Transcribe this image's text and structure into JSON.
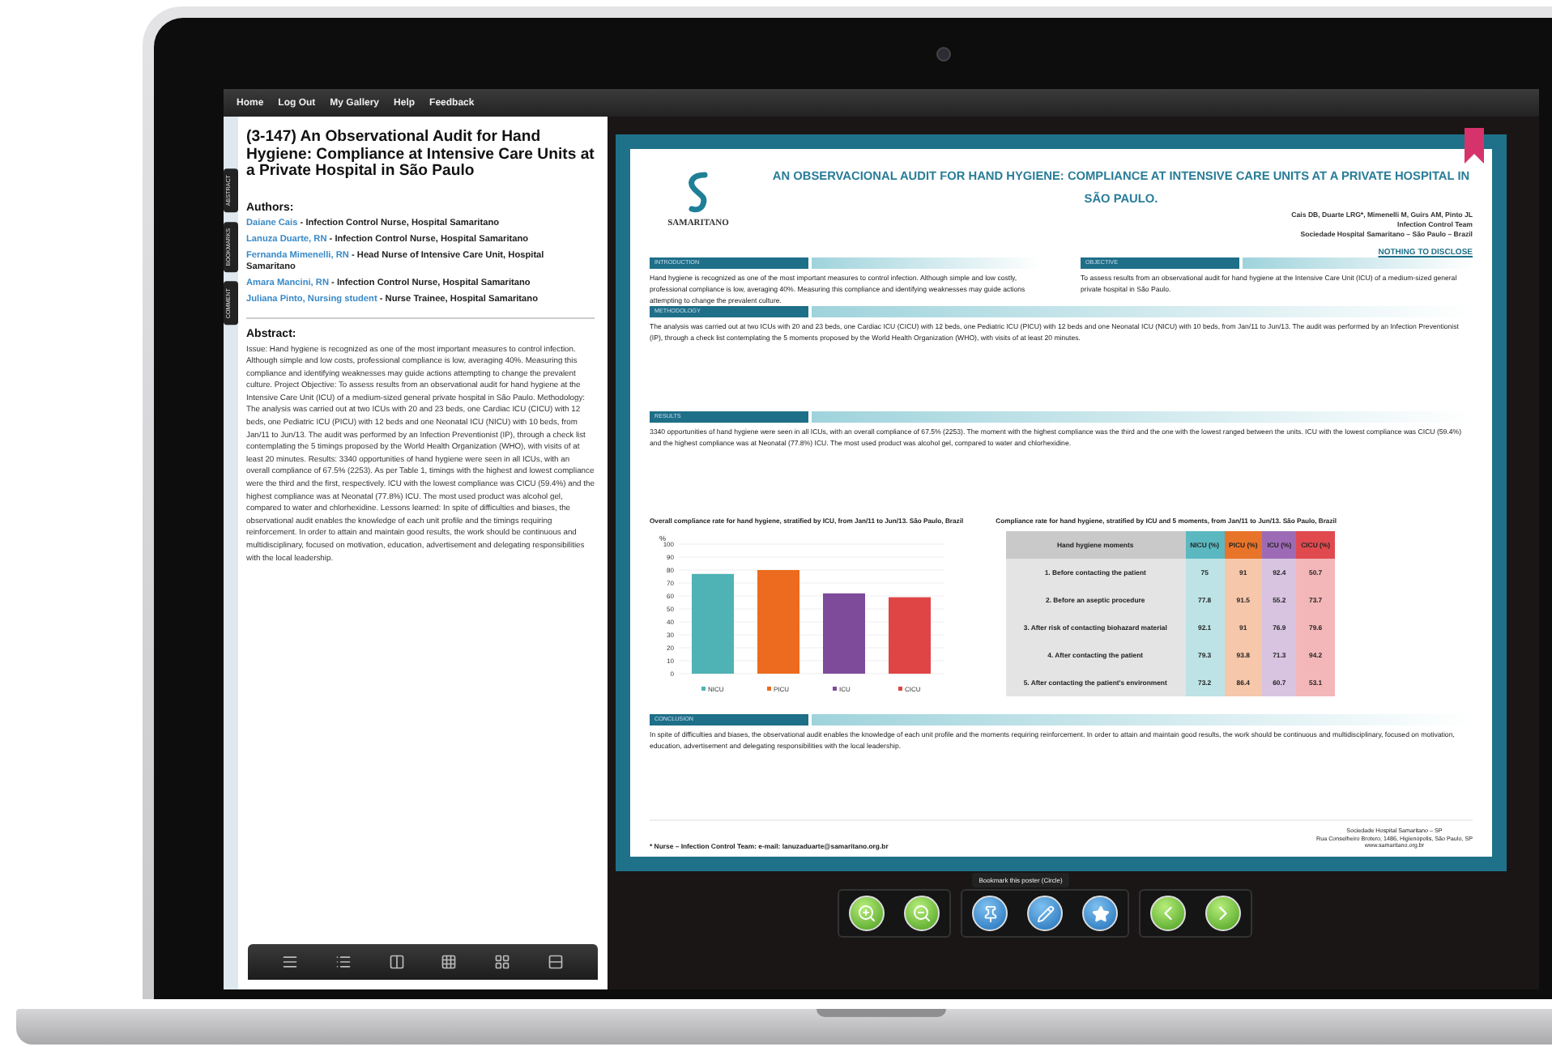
{
  "nav": [
    "Home",
    "Log Out",
    "My Gallery",
    "Help",
    "Feedback"
  ],
  "side_tabs": [
    "ABSTRACT",
    "BOOKMARKS",
    "COMMENT"
  ],
  "abstract_panel": {
    "title": "(3-147) An Observational Audit for Hand Hygiene: Compliance at Intensive Care Units at a Private Hospital in São Paulo",
    "authors_heading": "Authors:",
    "authors": [
      {
        "name": "Daiane Cais",
        "role": "- Infection Control Nurse, Hospital Samaritano"
      },
      {
        "name": "Lanuza Duarte, RN",
        "role": "- Infection Control Nurse, Hospital Samaritano"
      },
      {
        "name": "Fernanda Mimenelli, RN",
        "role": "- Head Nurse of Intensive Care Unit, Hospital Samaritano"
      },
      {
        "name": "Amara Mancini, RN",
        "role": "- Infection Control Nurse, Hospital Samaritano"
      },
      {
        "name": "Juliana Pinto, Nursing student",
        "role": "- Nurse Trainee, Hospital Samaritano"
      }
    ],
    "abstract_heading": "Abstract:",
    "abstract": "Issue: Hand hygiene is recognized as one of the most important measures to control infection. Although simple and low costs, professional compliance is low, averaging 40%. Measuring this compliance and identifying weaknesses may guide actions attempting to change the prevalent culture. Project Objective: To assess results from an observational audit for hand hygiene at the Intensive Care Unit (ICU) of a medium-sized general private hospital in São Paulo. Methodology: The analysis was carried out at two ICUs with 20 and 23 beds, one Cardiac ICU (CICU) with 12 beds, one Pediatric ICU (PICU) with 12 beds and one Neonatal ICU (NICU) with 10 beds, from Jan/11 to Jun/13. The audit was performed by an Infection Preventionist (IP), through a check list contemplating the 5 timings proposed by the World Health Organization (WHO), with visits of at least 20 minutes. Results: 3340 opportunities of hand hygiene were seen in all ICUs, with an overall compliance of 67.5% (2253). As per Table 1, timings with the highest and lowest compliance were the third and the first, respectively. ICU with the lowest compliance was CICU (59.4%) and the highest compliance was at Neonatal (77.8%) ICU. The most used product was alcohol gel, compared to water and chlorhexidine. Lessons learned: In spite of difficulties and biases, the observational audit enables the knowledge of each unit profile and the timings requiring reinforcement. In order to attain and maintain good results, the work should be continuous and multidisciplinary, focused on motivation, education, advertisement and delegating responsibilities with the local leadership."
  },
  "poster": {
    "logo": "SAMARITANO",
    "title": "AN OBSERVACIONAL AUDIT FOR HAND HYGIENE: COMPLIANCE AT INTENSIVE CARE UNITS AT A PRIVATE HOSPITAL IN SÃO PAULO.",
    "authors": "Cais DB, Duarte LRG*, Mimenelli M, Guirs AM, Pinto JL",
    "team": "Infection Control Team",
    "institution": "Sociedade Hospital Samaritano – São Paulo – Brazil",
    "disclosure": "NOTHING TO DISCLOSE",
    "top_sections": [
      {
        "heading": "INTRODUCTION",
        "text": "Hand hygiene is recognized as one of the most important measures to control infection. Although simple and low costly, professional compliance is low, averaging 40%. Measuring this compliance and identifying weaknesses may guide actions attempting to change the prevalent culture."
      },
      {
        "heading": "OBJECTIVE",
        "text": "To assess results from an observational audit for hand hygiene at the Intensive Care Unit (ICU) of a medium-sized general private hospital in São Paulo."
      }
    ],
    "middle_sections": [
      {
        "heading": "METHODOLOGY",
        "text": "The analysis was carried out at two ICUs with 20 and 23 beds, one Cardiac ICU (CICU) with 12 beds, one Pediatric ICU (PICU) with 12 beds and one Neonatal ICU (NICU) with 10 beds, from Jan/11 to Jun/13. The audit was performed by an Infection Preventionist (IP), through a check list contemplating the 5 moments proposed by the World Health Organization (WHO), with visits of at least 20 minutes."
      },
      {
        "heading": "RESULTS",
        "text": "3340 opportunities of hand hygiene were seen in all ICUs, with an overall compliance of 67.5% (2253). The moment with the highest compliance was the third and the one with the lowest ranged between the units. ICU with the lowest compliance was CICU (59.4%) and the highest compliance was at Neonatal (77.8%) ICU. The most used product was alcohol gel, compared to water and chlorhexidine."
      }
    ],
    "chart_caption": "Overall compliance rate for hand hygiene, stratified by ICU, from Jan/11 to Jun/13. São Paulo, Brazil",
    "chart_data": {
      "type": "bar",
      "ylabel": "%",
      "grid": true,
      "legend": "bottom",
      "series": [
        {
          "name": "NICU",
          "color": "#4fb3b5",
          "values": [
            77
          ]
        },
        {
          "name": "PICU",
          "color": "#ec6b1e",
          "values": [
            80
          ]
        },
        {
          "name": "ICU",
          "color": "#7e4b9a",
          "values": [
            62
          ]
        },
        {
          "name": "CICU",
          "color": "#e04546",
          "values": [
            59
          ]
        }
      ],
      "ylim": [
        0,
        100
      ],
      "yticks": [
        0,
        10,
        20,
        30,
        40,
        50,
        60,
        70,
        80,
        90,
        100
      ]
    },
    "table_caption": "Compliance rate for hand hygiene, stratified by ICU and 5 moments, from Jan/11 to Jun/13. São Paulo, Brazil",
    "table": {
      "first_column": "Hand hygiene moments",
      "columns": [
        {
          "label": "NICU (%)",
          "color": "#5bb8c0"
        },
        {
          "label": "PICU (%)",
          "color": "#e8742a"
        },
        {
          "label": "ICU (%)",
          "color": "#9d6bb5"
        },
        {
          "label": "CICU (%)",
          "color": "#e04a4f"
        }
      ],
      "rows": [
        {
          "moment": "1. Before contacting the patient",
          "values": [
            "75",
            "91",
            "92.4",
            "50.7"
          ]
        },
        {
          "moment": "2. Before an aseptic procedure",
          "values": [
            "77.8",
            "91.5",
            "55.2",
            "73.7"
          ]
        },
        {
          "moment": "3. After risk of contacting biohazard material",
          "values": [
            "92.1",
            "91",
            "76.9",
            "79.6"
          ]
        },
        {
          "moment": "4. After contacting the patient",
          "values": [
            "79.3",
            "93.8",
            "71.3",
            "94.2"
          ]
        },
        {
          "moment": "5. After contacting the patient's environment",
          "values": [
            "73.2",
            "86.4",
            "60.7",
            "53.1"
          ]
        }
      ]
    },
    "bottom_section": {
      "heading": "CONCLUSION",
      "text": "In spite of difficulties and biases, the observational audit enables the knowledge of each unit profile and the moments requiring reinforcement. In order to attain and maintain good results, the work should be continuous and multidisciplinary, focused on motivation, education, advertisement and delegating responsibilities with the local leadership."
    },
    "footnote": "* Nurse – Infection Control Team: e-mail: lanuzaduarte@samaritano.org.br",
    "contact": [
      "Sociedade Hospital Samaritano – SP",
      "Rua Conselheiro Brotero, 1486, Higienópolis, São Paulo, SP",
      "www.samaritano.org.br"
    ]
  },
  "toolbar": {
    "tooltip": "Bookmark this poster (Circle)"
  }
}
